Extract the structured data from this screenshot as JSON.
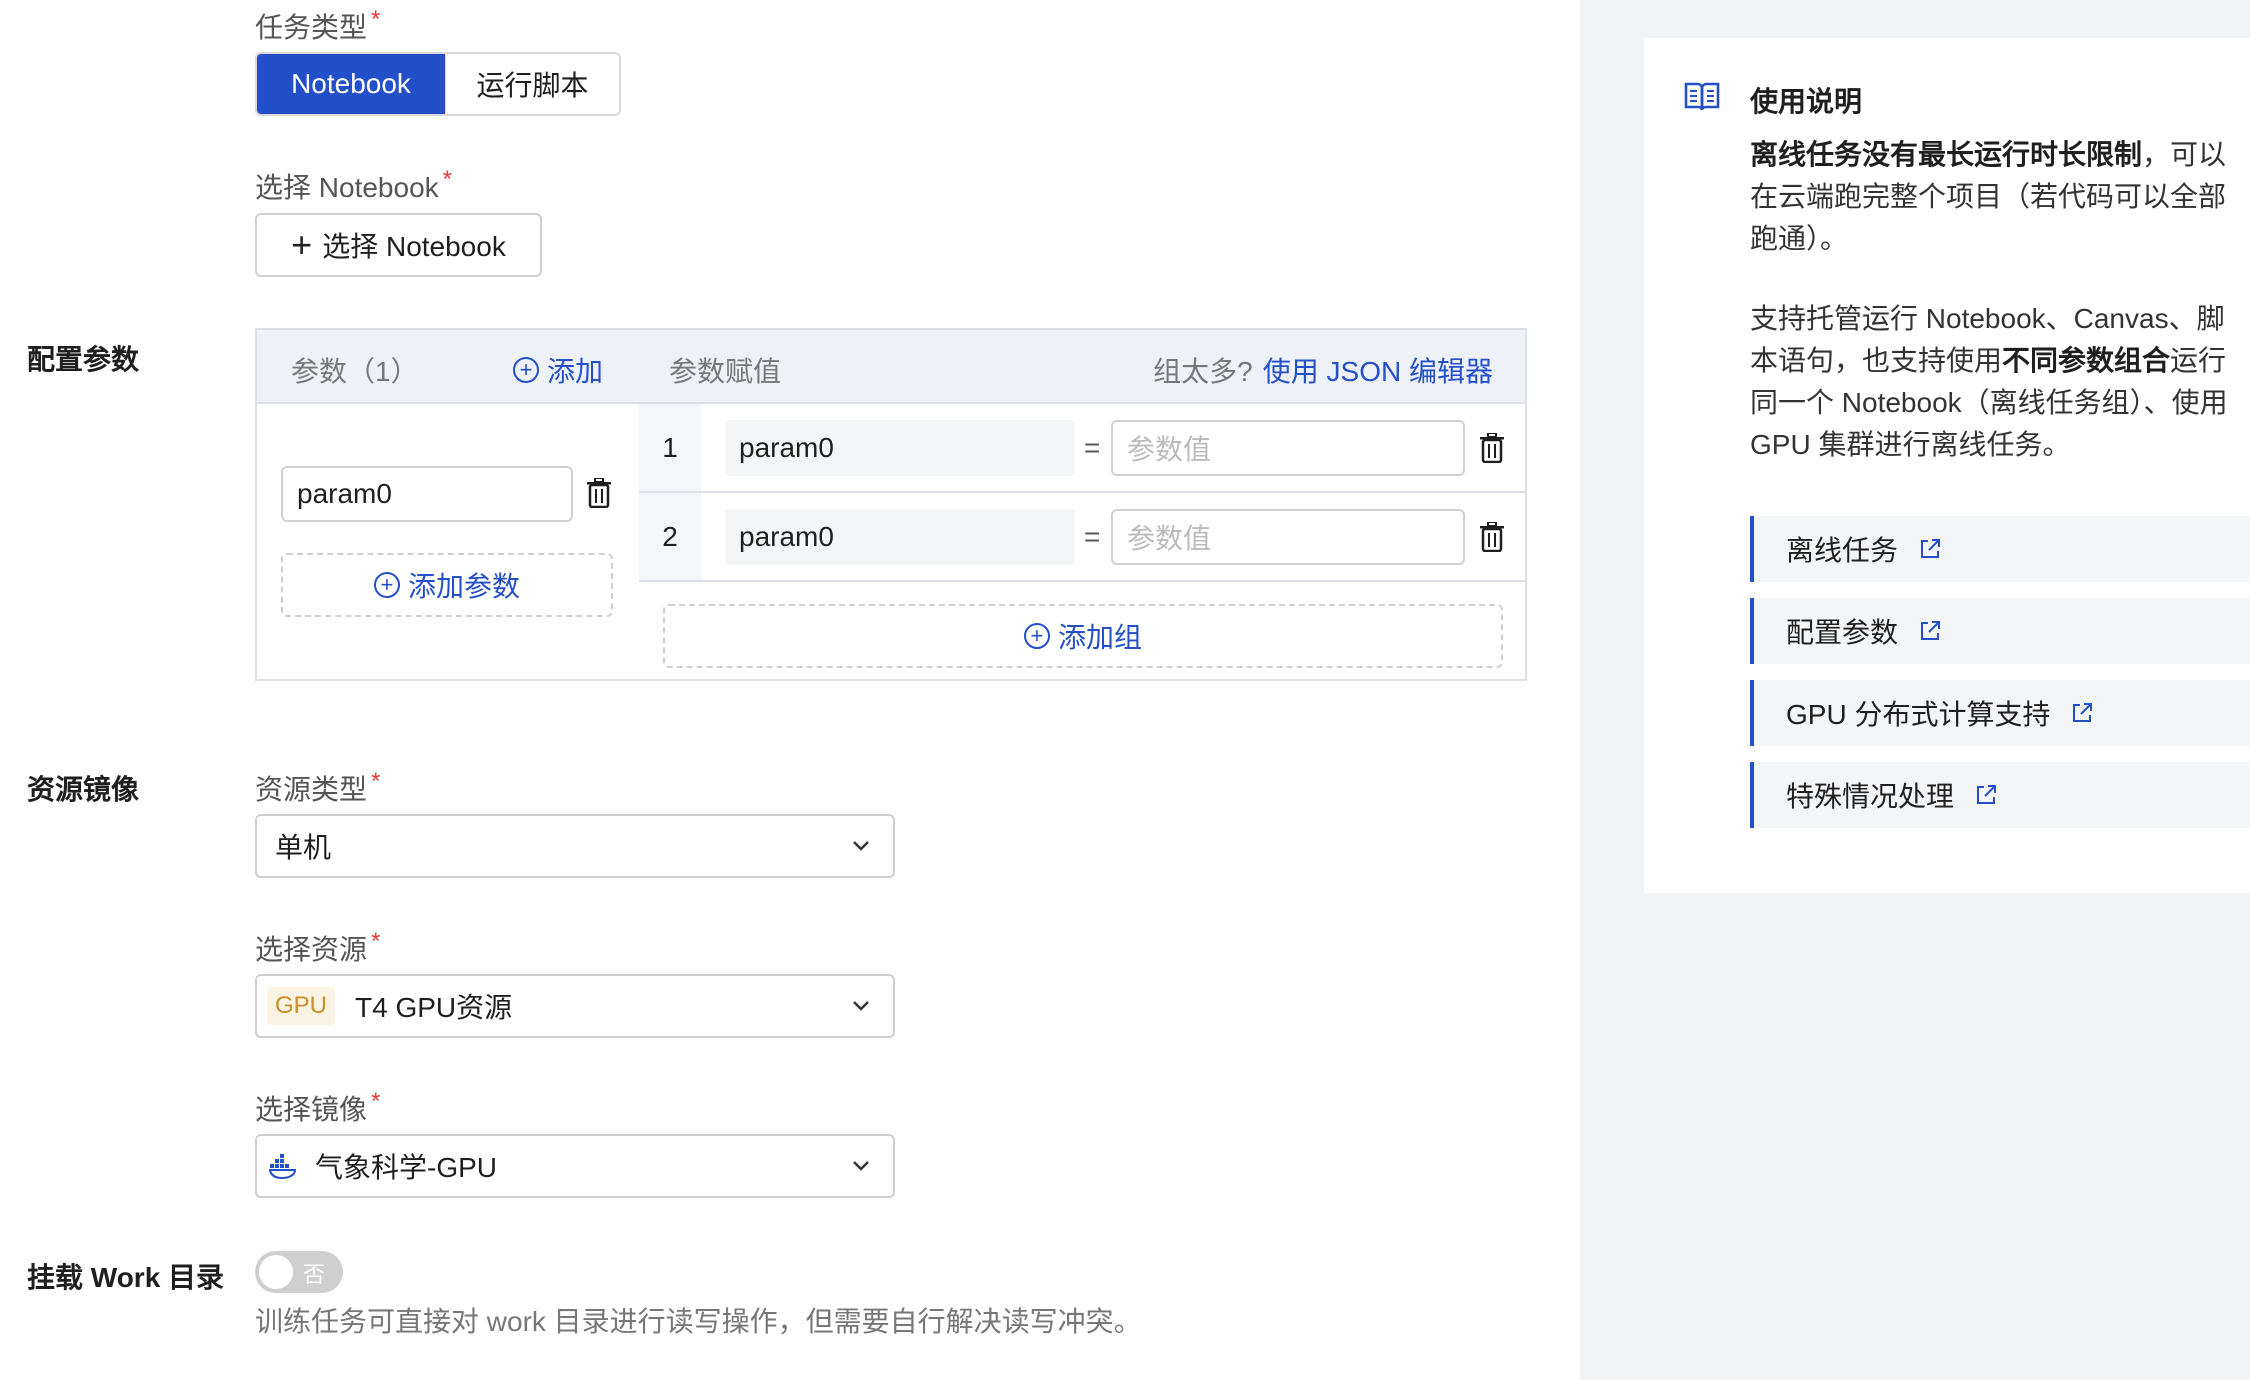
{
  "task_type": {
    "label": "任务类型",
    "options": [
      "Notebook",
      "运行脚本"
    ],
    "selected": "Notebook"
  },
  "select_notebook": {
    "label": "选择 Notebook",
    "button": "选择 Notebook"
  },
  "config_params": {
    "section_label": "配置参数",
    "header_params": "参数（1）",
    "header_add": "添加",
    "header_assign": "参数赋值",
    "header_too_many": "组太多?",
    "header_json_link": "使用 JSON 编辑器",
    "params": [
      "param0"
    ],
    "add_param": "添加参数",
    "rows": [
      {
        "index": "1",
        "name": "param0",
        "eq": "=",
        "placeholder": "参数值"
      },
      {
        "index": "2",
        "name": "param0",
        "eq": "=",
        "placeholder": "参数值"
      }
    ],
    "add_group": "添加组"
  },
  "resource_image": {
    "section_label": "资源镜像",
    "resource_type_label": "资源类型",
    "resource_type_value": "单机",
    "resource_label": "选择资源",
    "resource_tag": "GPU",
    "resource_value": "T4 GPU资源",
    "image_label": "选择镜像",
    "image_value": "气象科学-GPU"
  },
  "mount_work": {
    "section_label": "挂载 Work 目录",
    "toggle_label": "否",
    "hint": "训练任务可直接对 work 目录进行读写操作，但需要自行解决读写冲突。"
  },
  "help": {
    "title": "使用说明",
    "para1_bold": "离线任务没有最长运行时长限制",
    "para1_rest": "，可以在云端跑完整个项目（若代码可以全部跑通）。",
    "para2_a": "支持托管运行 Notebook、Canvas、脚本语句，也支持使用",
    "para2_bold": "不同参数组合",
    "para2_b": "运行同一个 Notebook（离线任务组）、使用 GPU 集群进行离线任务。",
    "links": [
      "离线任务",
      "配置参数",
      "GPU 分布式计算支持",
      "特殊情况处理"
    ]
  },
  "colors": {
    "primary": "#2350c9",
    "required": "#e23b3b",
    "gpu_tag_text": "#c9902a",
    "side_bg": "#f2f3f5"
  }
}
